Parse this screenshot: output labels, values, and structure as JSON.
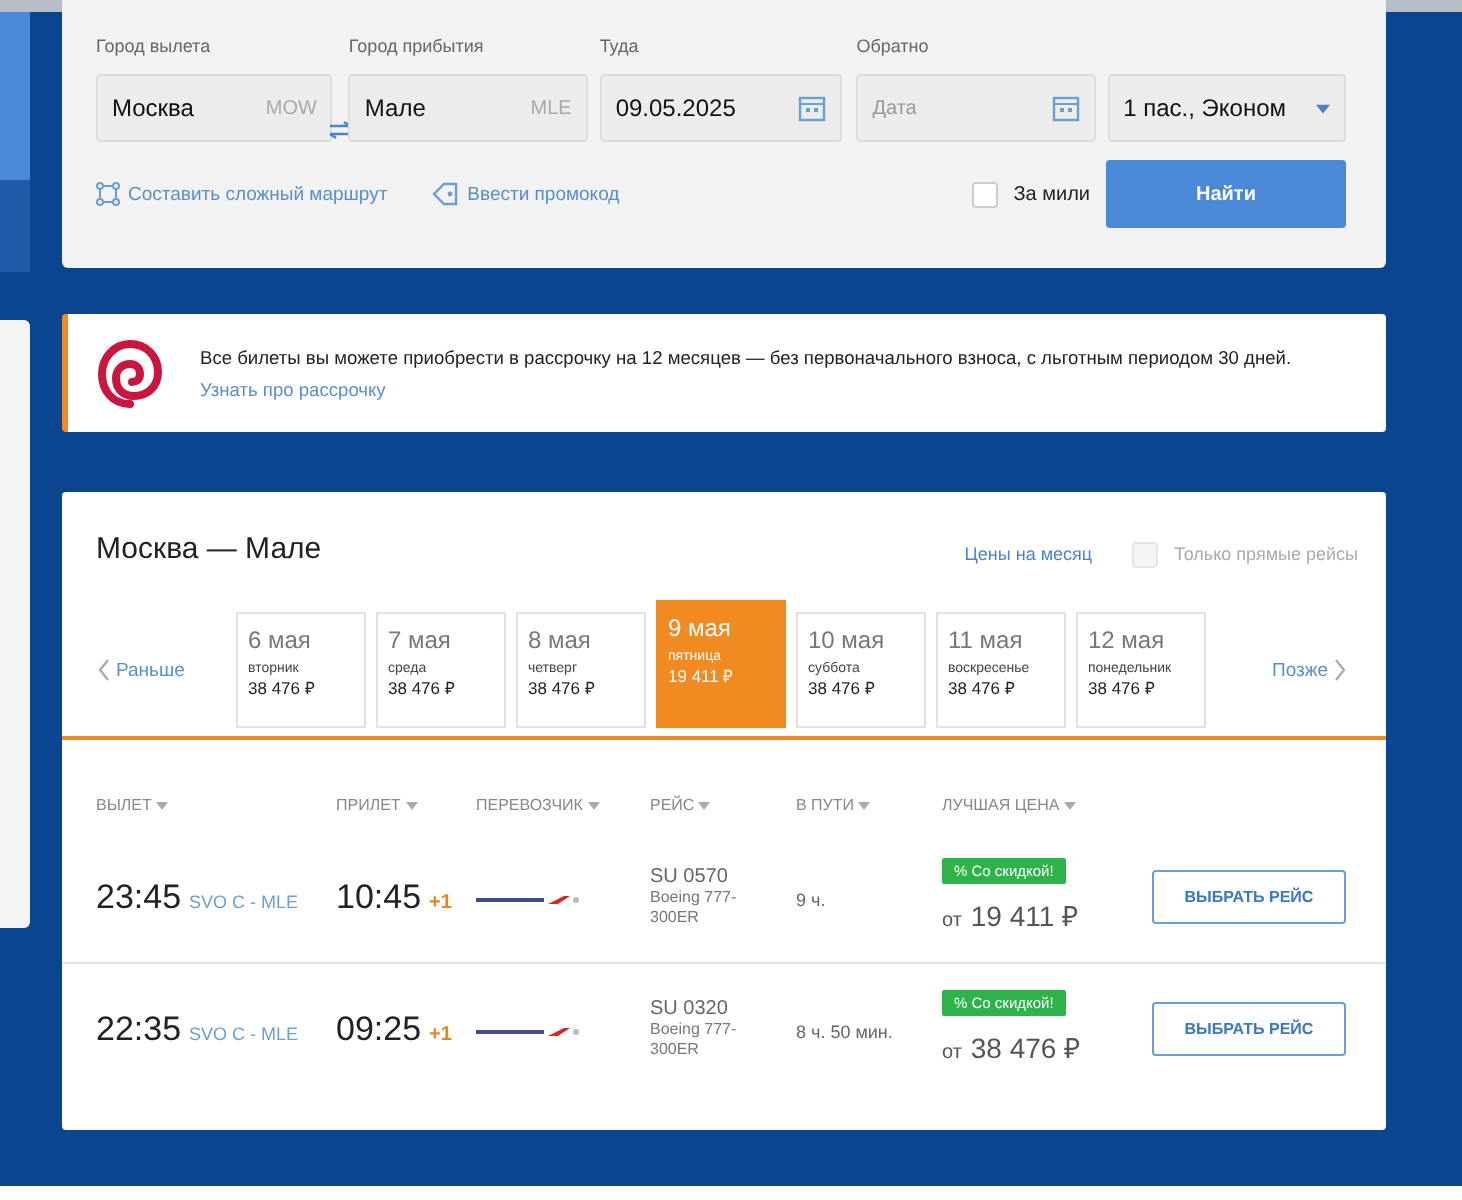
{
  "search_form": {
    "fields": [
      {
        "kind": "city",
        "label": "Город вылета",
        "value": "Москва",
        "code": "MOW"
      },
      {
        "kind": "city",
        "label": "Город прибытия",
        "value": "Мале",
        "code": "MLE"
      },
      {
        "kind": "date",
        "label": "Туда",
        "value": "09.05.2025"
      },
      {
        "kind": "date",
        "label": "Обратно",
        "placeholder": "Дата"
      },
      {
        "kind": "select",
        "value": "1 пас., Эконом"
      }
    ],
    "links": [
      {
        "kind": "route",
        "label": "Составить сложный маршрут"
      },
      {
        "kind": "promo",
        "label": "Ввести промокод"
      }
    ],
    "miles": {
      "label": "За мили",
      "checked": false
    },
    "search_button": "Найти"
  },
  "banner": {
    "text": "Все билеты вы можете приобрести в рассрочку на 12 месяцев — без первоначального взноса, с льготным периодом 30 дней.",
    "link": "Узнать про рассрочку"
  },
  "results": {
    "title": "Москва — Мале",
    "month_prices": "Цены на месяц",
    "direct_only": {
      "label": "Только прямые рейсы",
      "checked": false,
      "disabled": true
    },
    "earlier": "Раньше",
    "later": "Позже",
    "dates": [
      {
        "date": "6 мая",
        "weekday": "вторник",
        "price": "38 476 ₽",
        "selected": false
      },
      {
        "date": "7 мая",
        "weekday": "среда",
        "price": "38 476 ₽",
        "selected": false
      },
      {
        "date": "8 мая",
        "weekday": "четверг",
        "price": "38 476 ₽",
        "selected": false
      },
      {
        "date": "9 мая",
        "weekday": "пятница",
        "price": "19 411 ₽",
        "selected": true
      },
      {
        "date": "10 мая",
        "weekday": "суббота",
        "price": "38 476 ₽",
        "selected": false
      },
      {
        "date": "11 мая",
        "weekday": "воскресенье",
        "price": "38 476 ₽",
        "selected": false
      },
      {
        "date": "12 мая",
        "weekday": "понедельник",
        "price": "38 476 ₽",
        "selected": false
      }
    ],
    "columns": [
      "ВЫЛЕТ",
      "ПРИЛЕТ",
      "ПЕРЕВОЗЧИК",
      "РЕЙС",
      "В ПУТИ",
      "ЛУЧШАЯ ЦЕНА"
    ],
    "flights": [
      {
        "departure": "23:45",
        "route": "SVO C - MLE",
        "arrival": "10:45",
        "day_shift": "+1",
        "flight": "SU 0570",
        "aircraft": "Boeing 777-300ER",
        "duration": "9 ч.",
        "badge": "% Со скидкой!",
        "price_prefix": "от",
        "price": "19 411 ₽",
        "button": "ВЫБРАТЬ РЕЙС"
      },
      {
        "departure": "22:35",
        "route": "SVO C - MLE",
        "arrival": "09:25",
        "day_shift": "+1",
        "flight": "SU 0320",
        "aircraft": "Boeing 777-300ER",
        "duration": "8 ч. 50 мин.",
        "badge": "% Со скидкой!",
        "price_prefix": "от",
        "price": "38 476 ₽",
        "button": "ВЫБРАТЬ РЕЙС"
      }
    ]
  }
}
